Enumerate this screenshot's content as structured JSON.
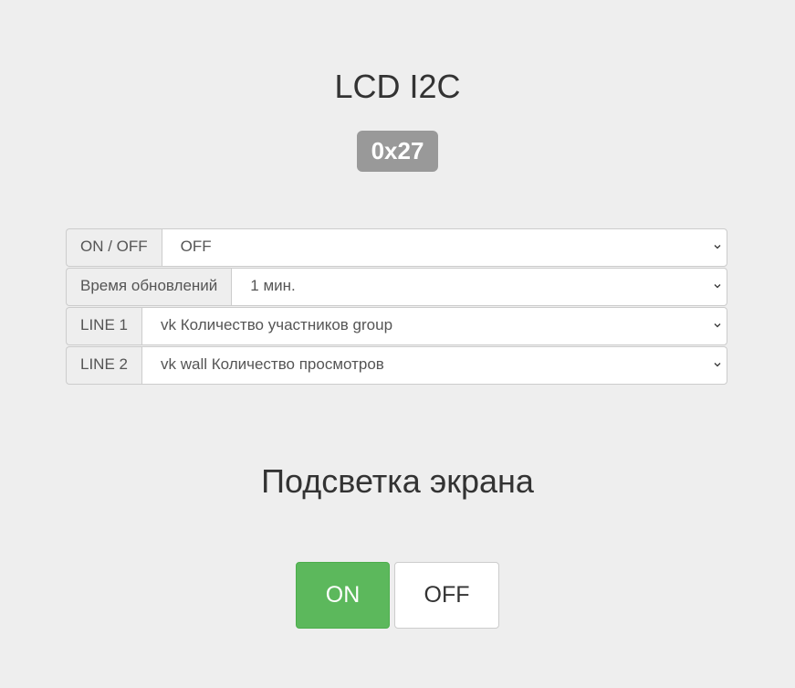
{
  "header": {
    "title": "LCD I2C",
    "address_badge": "0x27"
  },
  "settings": [
    {
      "label": "ON / OFF",
      "value": "OFF"
    },
    {
      "label": "Время обновлений",
      "value": "1 мин."
    },
    {
      "label": "LINE 1",
      "value": "vk Количество участников group"
    },
    {
      "label": "LINE 2",
      "value": "vk wall Количество просмотров"
    }
  ],
  "backlight": {
    "title": "Подсветка экрана",
    "on_label": "ON",
    "off_label": "OFF"
  },
  "colors": {
    "background": "#eeeeee",
    "badge": "#999999",
    "on_button": "#5cb85c"
  }
}
